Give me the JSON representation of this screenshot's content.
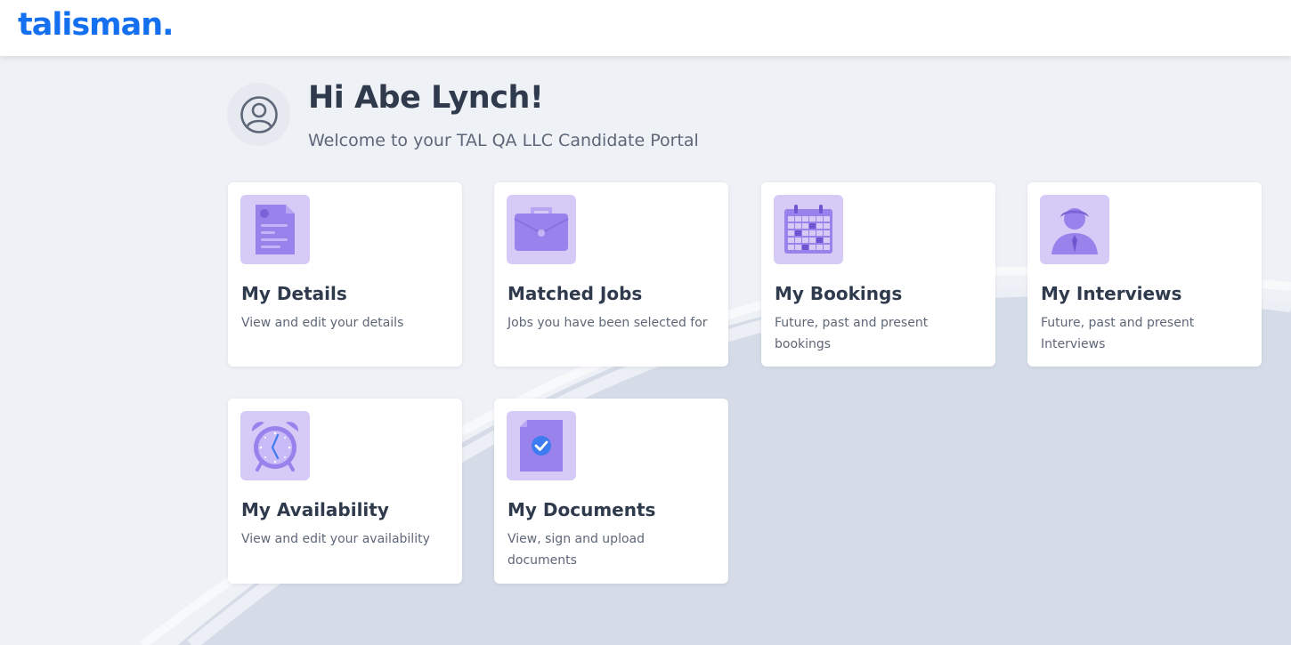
{
  "header": {
    "logo_text": "talisman.",
    "brand_color": "#1570ef"
  },
  "welcome": {
    "greeting": "Hi Abe Lynch!",
    "subtitle": "Welcome to your TAL QA LLC Candidate Portal",
    "avatar_icon": "user-circle-icon"
  },
  "cards": [
    {
      "title": "My Details",
      "description": "View and edit your details",
      "icon": "document-icon"
    },
    {
      "title": "Matched Jobs",
      "description": "Jobs you have been selected for",
      "icon": "briefcase-icon"
    },
    {
      "title": "My Bookings",
      "description": "Future, past and present bookings",
      "icon": "calendar-icon"
    },
    {
      "title": "My Interviews",
      "description": "Future, past and present Interviews",
      "icon": "person-icon"
    },
    {
      "title": "My Availability",
      "description": "View and edit your availability",
      "icon": "alarm-clock-icon"
    },
    {
      "title": "My Documents",
      "description": "View, sign and upload documents",
      "icon": "signed-document-icon"
    }
  ],
  "colors": {
    "page_background": "#eef1f6",
    "tile_background": "#d6cbf6",
    "icon_purple": "#9a82ec",
    "text_dark": "#2f3a4d",
    "text_muted": "#5d6778"
  }
}
